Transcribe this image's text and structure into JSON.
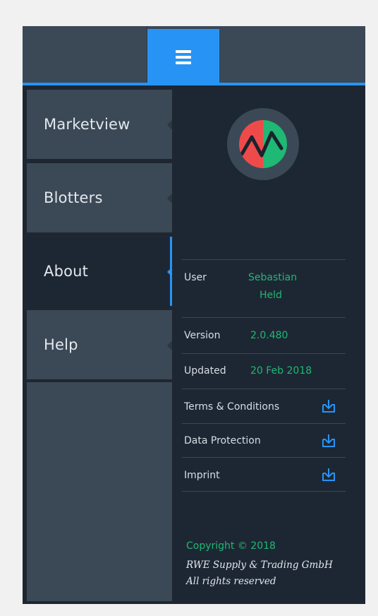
{
  "header": {
    "menu_icon": "hamburger-menu-icon",
    "accent_color": "#2794f5"
  },
  "nav": {
    "items": [
      {
        "label": "Marketview",
        "active": false
      },
      {
        "label": "Blotters",
        "active": false
      },
      {
        "label": "About",
        "active": true
      },
      {
        "label": "Help",
        "active": false
      }
    ]
  },
  "about": {
    "logo_icon": "market-chart-logo-icon",
    "user": {
      "label": "User",
      "value_line1": "Sebastian",
      "value_line2": "Held"
    },
    "version": {
      "label": "Version",
      "value": "2.0.480"
    },
    "updated": {
      "label": "Updated",
      "value": "20 Feb 2018"
    },
    "documents": [
      {
        "label": "Terms & Conditions",
        "icon": "download-icon"
      },
      {
        "label": "Data Protection",
        "icon": "download-icon"
      },
      {
        "label": "Imprint",
        "icon": "download-icon"
      }
    ],
    "copyright": "Copyright © 2018",
    "company": "RWE Supply & Trading GmbH",
    "rights": "All rights reserved"
  },
  "colors": {
    "value_text": "#1fb874",
    "logo_red": "#ef4a4a",
    "logo_green": "#1fb874"
  }
}
